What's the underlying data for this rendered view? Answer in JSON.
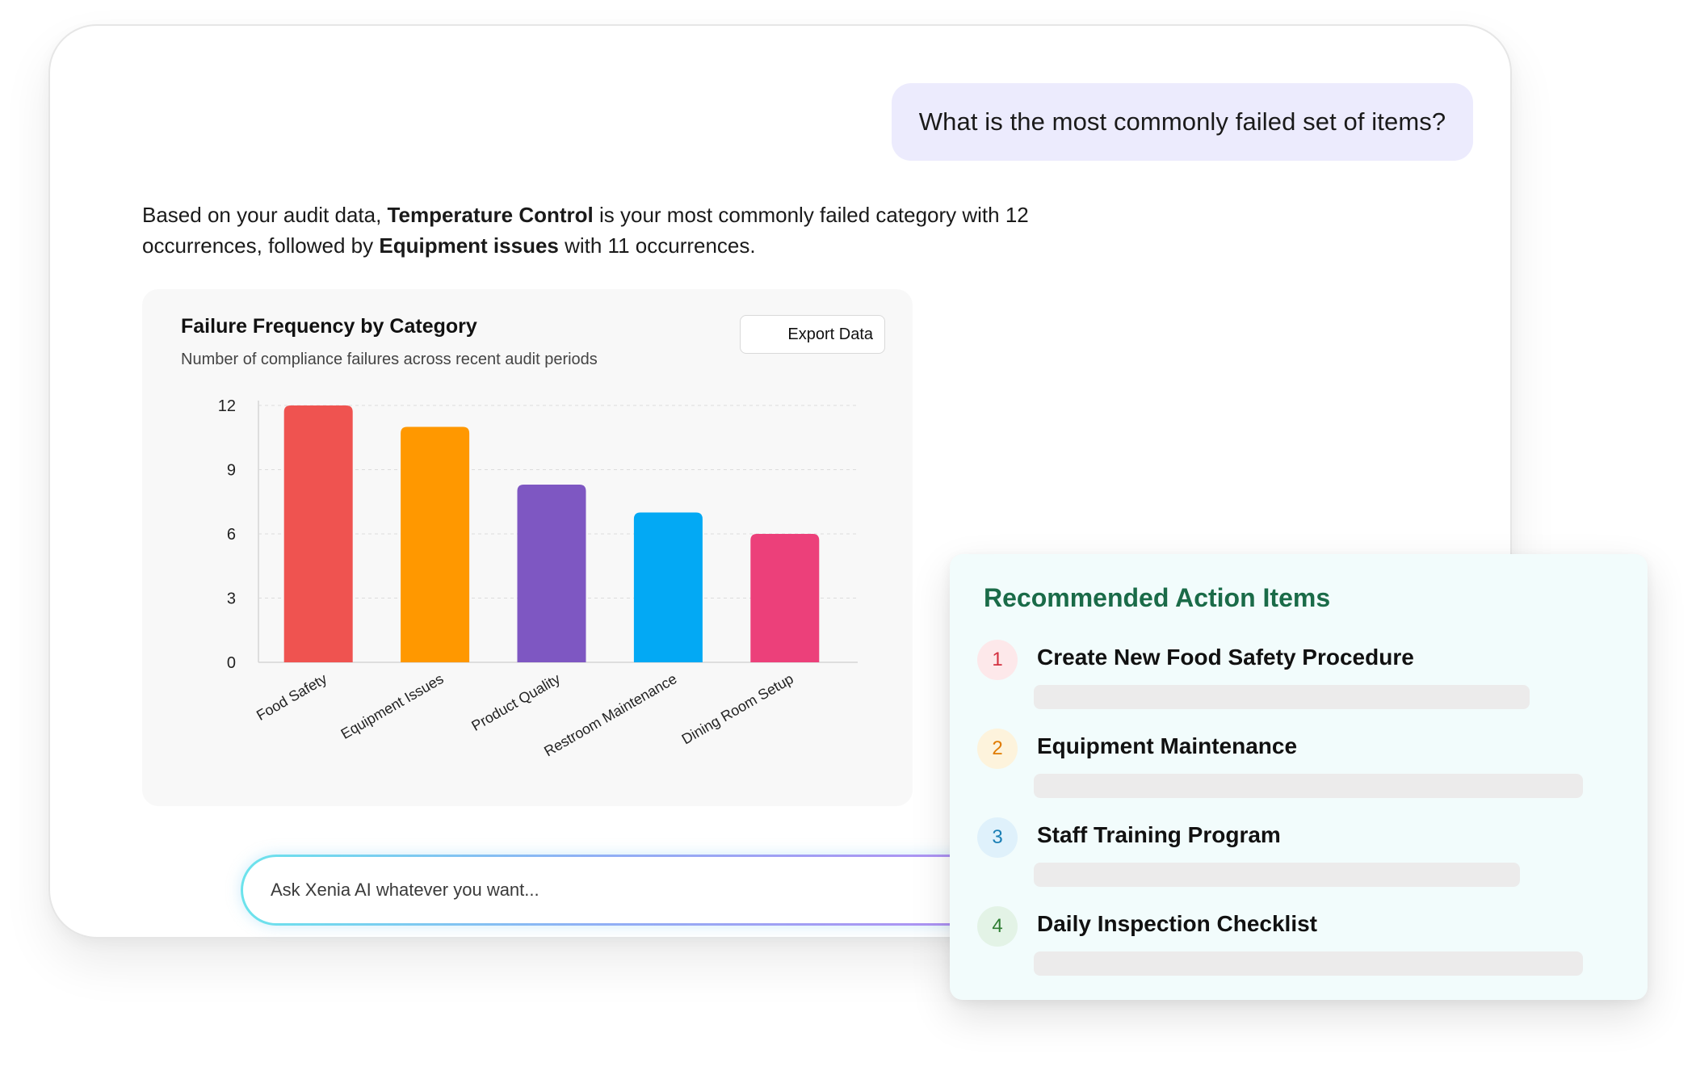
{
  "conversation": {
    "user_question": "What is the most commonly failed set of items?",
    "answer": {
      "p1": "Based on your audit data, ",
      "b1": "Temperature Control",
      "p2": " is your most commonly failed category with 12 occurrences, followed by ",
      "b2": "Equipment issues",
      "p3": " with 11 occurrences."
    }
  },
  "chart_card": {
    "export_label": "Export Data"
  },
  "chart_data": {
    "type": "bar",
    "title": "Failure Frequency by Category",
    "subtitle": "Number of compliance failures across recent audit periods",
    "categories": [
      "Food Safety",
      "Equipment Issues",
      "Product Quality",
      "Restroom Maintenance",
      "Dining Room Setup"
    ],
    "values": [
      12,
      11,
      8.3,
      7,
      6
    ],
    "colors": [
      "#ef5350",
      "#ff9800",
      "#7e57c2",
      "#03a9f4",
      "#ec407a"
    ],
    "ylim": [
      0,
      12
    ],
    "yticks": [
      "0",
      "3",
      "6",
      "9",
      "12"
    ],
    "grid": true,
    "xlabel": "",
    "ylabel": ""
  },
  "ask_input": {
    "placeholder": "Ask Xenia AI whatever you want..."
  },
  "action_items": {
    "title": "Recommended Action Items",
    "items": [
      {
        "number": "1",
        "label": "Create New Food Safety Procedure",
        "badge_bg": "#fde8ea",
        "badge_fg": "#d32f3f"
      },
      {
        "number": "2",
        "label": "Equipment Maintenance",
        "badge_bg": "#fdf3dc",
        "badge_fg": "#e07b00"
      },
      {
        "number": "3",
        "label": "Staff Training Program",
        "badge_bg": "#dff1fb",
        "badge_fg": "#1a7fb5"
      },
      {
        "number": "4",
        "label": "Daily Inspection Checklist",
        "badge_bg": "#e3f3e6",
        "badge_fg": "#2e7d32"
      }
    ]
  }
}
